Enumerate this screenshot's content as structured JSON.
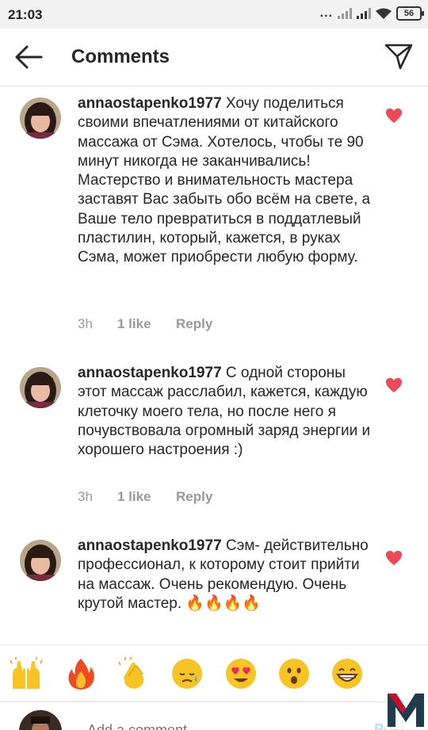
{
  "status_bar": {
    "time": "21:03",
    "battery": "56",
    "dots": "..."
  },
  "header": {
    "title": "Comments",
    "back_icon": "back-arrow-icon",
    "send_icon": "paper-plane-icon"
  },
  "comments": [
    {
      "username": "annaostapenko1977",
      "text": " Хочу поделиться своими впечатлениями от китайского массажа от Сэма. Хотелось, чтобы те 90 минут никогда не заканчивались! Мастерство и  внимательность мастера заставят Вас забыть обо всём на свете, а Ваше тело превратиться в поддатлевый пластилин, который, кажется, в руках Сэма, может приобрести любую форму.",
      "time": "3h",
      "likes": "1 like",
      "reply": "Reply",
      "liked": true
    },
    {
      "username": "annaostapenko1977",
      "text": " С одной стороны этот массаж расслабил, кажется, каждую клеточку моего тела, но после него я почувствовала огромный заряд энергии и хорошего настроения :)",
      "time": "3h",
      "likes": "1 like",
      "reply": "Reply",
      "liked": true
    },
    {
      "username": "annaostapenko1977",
      "text": " Сэм- действительно профессионал, к которому стоит прийти на массаж. Очень рекомендую. Очень крутой мастер. 🔥🔥🔥🔥",
      "liked": true
    }
  ],
  "emoji_bar": [
    "raising-hands",
    "fire",
    "clapping-hands",
    "crying-face",
    "heart-eyes-face",
    "surprised-face",
    "grinning-face"
  ],
  "composer": {
    "placeholder": "Add a comment...",
    "post_label": "Post"
  },
  "colors": {
    "heart": "#ed4956",
    "meta_text": "#999999",
    "post_disabled": "#b2dffc",
    "status_bar_bg": "#f2f2f2",
    "logo_red": "#c8102e"
  }
}
